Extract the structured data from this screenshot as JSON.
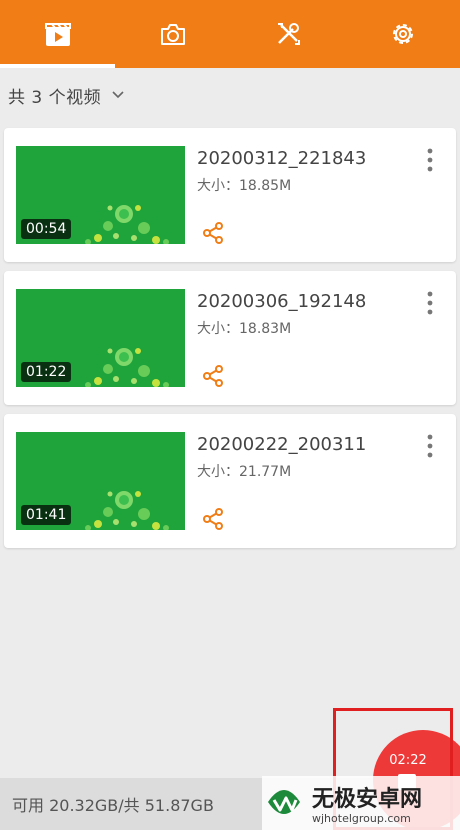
{
  "tabs": [
    {
      "name": "videos",
      "icon": "film-icon",
      "active": true
    },
    {
      "name": "camera",
      "icon": "camera-icon",
      "active": false
    },
    {
      "name": "tools",
      "icon": "tools-icon",
      "active": false
    },
    {
      "name": "settings",
      "icon": "gear-icon",
      "active": false
    }
  ],
  "list_header": {
    "count_label": "共 3 个视频",
    "chevron": "chevron-down-icon"
  },
  "videos": [
    {
      "title": "20200312_221843",
      "size": "大小：18.85M",
      "duration": "00:54"
    },
    {
      "title": "20200306_192148",
      "size": "大小：18.83M",
      "duration": "01:22"
    },
    {
      "title": "20200222_200311",
      "size": "大小：21.77M",
      "duration": "01:41"
    }
  ],
  "footer": {
    "storage": "可用 20.32GB/共 51.87GB"
  },
  "recording": {
    "time": "02:22"
  },
  "watermark": {
    "brand": "无极安卓网",
    "url": "wjhotelgroup.com"
  },
  "colors": {
    "accent": "#f07d16",
    "record": "#ee3939",
    "thumb_bg": "#1fa33b"
  }
}
